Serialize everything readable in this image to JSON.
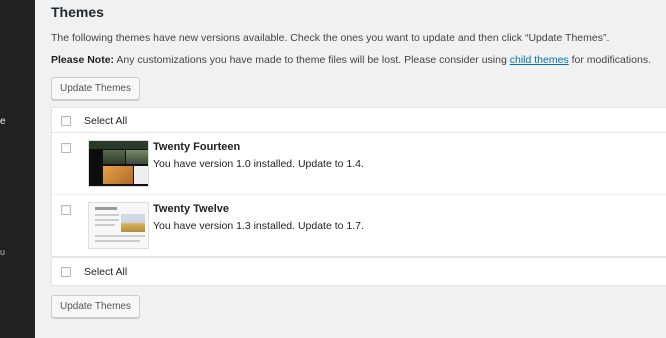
{
  "sidebar": {
    "fragment_a": "e",
    "fragment_b": "u"
  },
  "section": {
    "title": "Themes"
  },
  "intro": "The following themes have new versions available. Check the ones you want to update and then click “Update Themes”.",
  "note": {
    "label": "Please Note:",
    "text_before": " Any customizations you have made to theme files will be lost. Please consider using ",
    "link": "child themes",
    "text_after": " for modifications."
  },
  "buttons": {
    "update_top": "Update Themes",
    "update_bottom": "Update Themes"
  },
  "table": {
    "select_all_top": "Select All",
    "select_all_bottom": "Select All",
    "themes": [
      {
        "name": "Twenty Fourteen",
        "description": "You have version 1.0 installed. Update to 1.4."
      },
      {
        "name": "Twenty Twelve",
        "description": "You have version 1.3 installed. Update to 1.7."
      }
    ]
  }
}
